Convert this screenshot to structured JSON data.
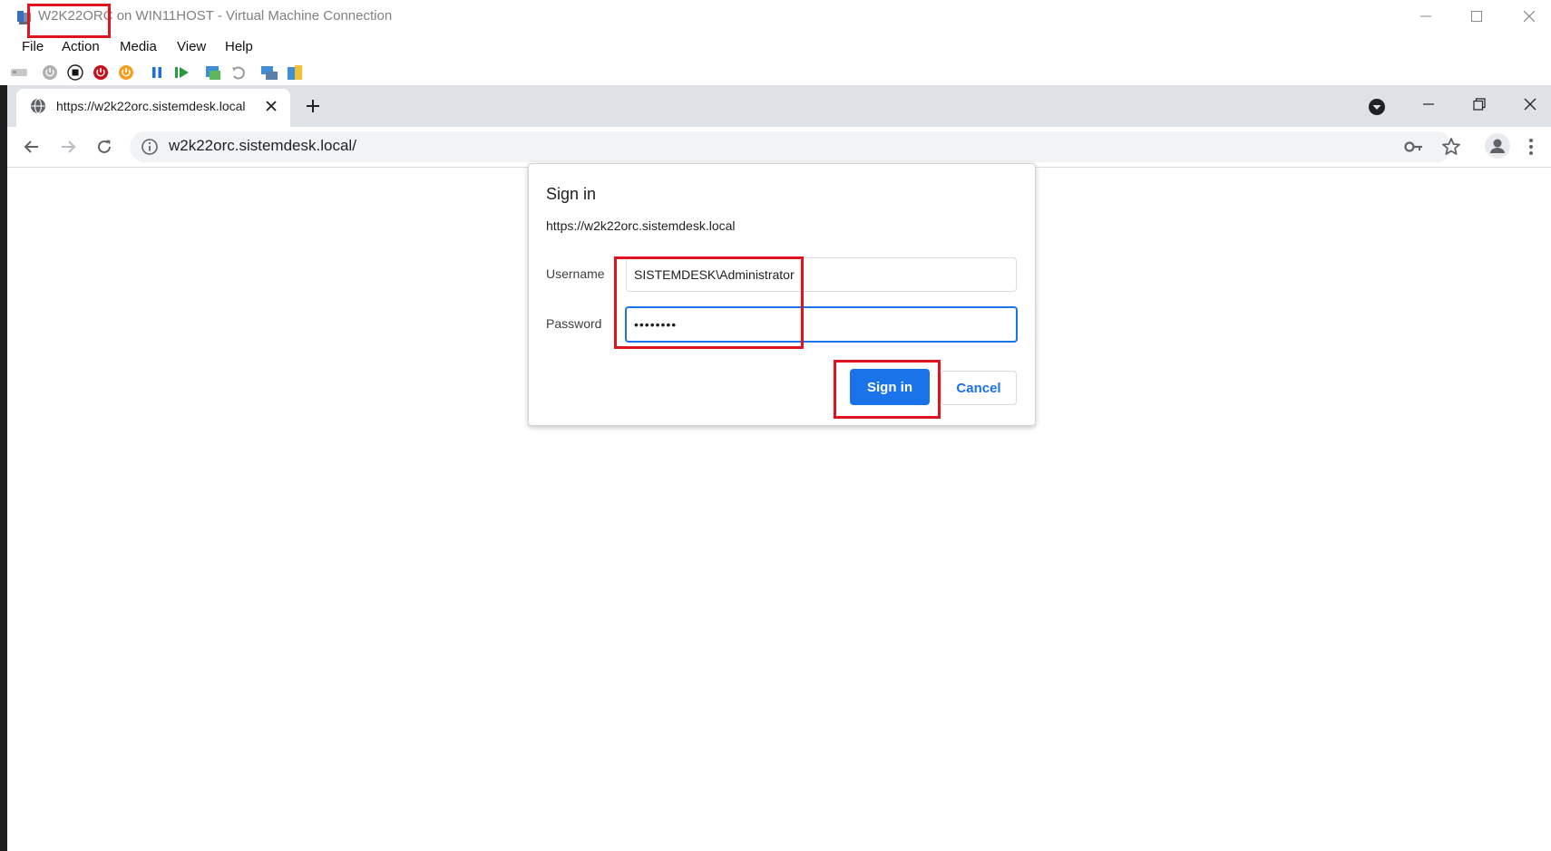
{
  "window": {
    "title": "W2K22ORC on WIN11HOST - Virtual Machine Connection",
    "minimize_icon": "minimize-icon",
    "maximize_icon": "maximize-icon",
    "close_icon": "close-icon"
  },
  "menu": {
    "items": [
      "File",
      "Action",
      "Media",
      "View",
      "Help"
    ]
  },
  "vm_toolbar": {
    "buttons": [
      "ctrl-alt-del-icon",
      "start-icon",
      "turn-off-icon",
      "shut-down-icon",
      "save-state-icon",
      "pause-icon",
      "resume-icon",
      "checkpoint-icon",
      "revert-icon",
      "enhanced-session-icon",
      "share-icon"
    ]
  },
  "browser": {
    "tab": {
      "title": "https://w2k22orc.sistemdesk.local"
    },
    "address": "w2k22orc.sistemdesk.local/"
  },
  "dialog": {
    "title": "Sign in",
    "origin": "https://w2k22orc.sistemdesk.local",
    "username_label": "Username",
    "username_value": "SISTEMDESK\\Administrator",
    "password_label": "Password",
    "password_value": "••••••••",
    "sign_in_label": "Sign in",
    "cancel_label": "Cancel"
  },
  "colors": {
    "accent": "#1a73e8",
    "highlight": "#e0141e"
  }
}
